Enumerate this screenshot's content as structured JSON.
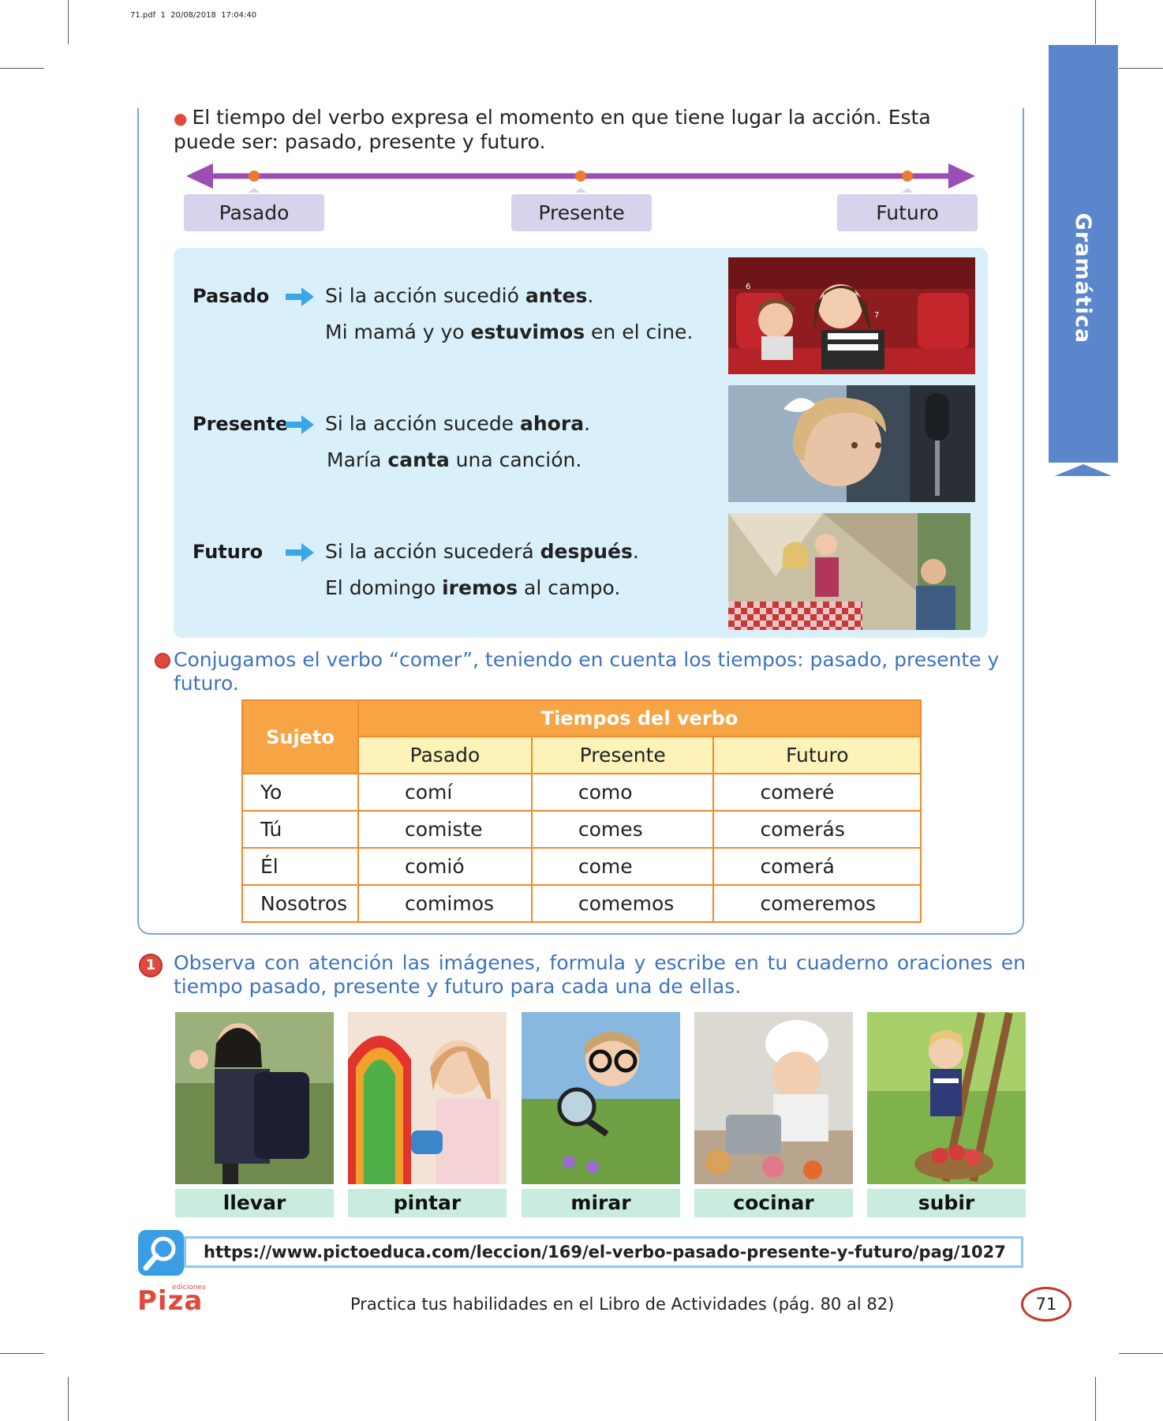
{
  "print_info": "71.pdf  1  20/08/2018  17:04:40",
  "side_tab": "Gramática",
  "intro": "El tiempo del verbo expresa el momento en que tiene lugar la acción. Esta puede ser: pasado, presente y futuro.",
  "timeline": {
    "labels": [
      "Pasado",
      "Presente",
      "Futuro"
    ]
  },
  "colors": {
    "accent_blue": "#3e73c0",
    "tab_blue": "#5b86cc",
    "timeline_purple": "#9b4fb5",
    "table_orange": "#f7a445",
    "label_mint": "#c9ecde",
    "box_blue": "#d9f0fb"
  },
  "tenses": [
    {
      "term": "Pasado",
      "line1_pre": "Si la acción sucedió ",
      "line1_bold": "antes",
      "line1_post": ".",
      "line2_pre": "Mi mamá y yo ",
      "line2_bold": "estuvimos",
      "line2_post": " en el cine."
    },
    {
      "term": "Presente",
      "line1_pre": "Si la acción sucede ",
      "line1_bold": "ahora",
      "line1_post": ".",
      "line2_pre": "María ",
      "line2_bold": "canta",
      "line2_post": " una canción."
    },
    {
      "term": "Futuro",
      "line1_pre": "Si la acción sucederá ",
      "line1_bold": "después",
      "line1_post": ".",
      "line2_pre": "El domingo ",
      "line2_bold": "iremos",
      "line2_post": " al campo."
    }
  ],
  "conjugation": {
    "title": "Conjugamos el verbo “comer”, teniendo en cuenta los tiempos: pasado, presente y futuro.",
    "header_subject": "Sujeto",
    "header_group": "Tiempos del verbo",
    "columns": [
      "Pasado",
      "Presente",
      "Futuro"
    ],
    "rows": [
      [
        "Yo",
        "comí",
        "como",
        "comeré"
      ],
      [
        "Tú",
        "comiste",
        "comes",
        "comerás"
      ],
      [
        "Él",
        "comió",
        "come",
        "comerá"
      ],
      [
        "Nosotros",
        "comimos",
        "comemos",
        "comeremos"
      ]
    ]
  },
  "exercise": {
    "number": "1",
    "text": "Observa con atención las imágenes, formula y escribe en tu cuaderno oraciones en tiempo pasado, presente y futuro para cada una de ellas.",
    "labels": [
      "llevar",
      "pintar",
      "mirar",
      "cocinar",
      "subir"
    ]
  },
  "link": "https://www.pictoeduca.com/leccion/169/el-verbo-pasado-presente-y-futuro/pag/1027",
  "logo_small": "ediciones",
  "logo": "Piza",
  "footer": "Practica tus habilidades en el Libro de Actividades (pág. 80 al 82)",
  "page_number": "71"
}
